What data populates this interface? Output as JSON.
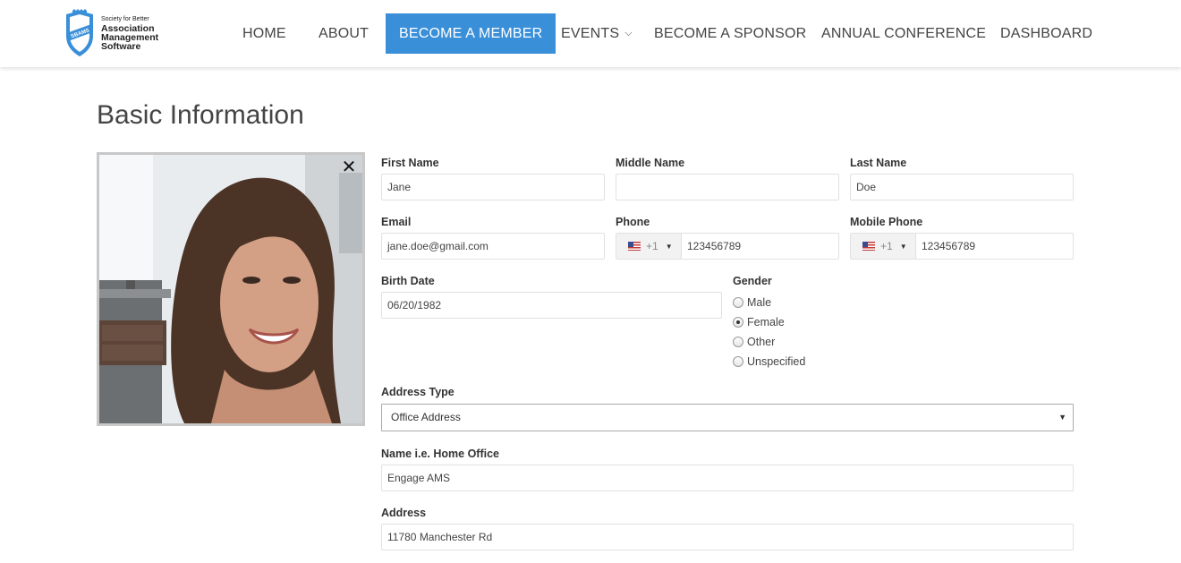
{
  "brand": {
    "small": "Society for Better",
    "line1": "Association",
    "line2": "Management",
    "line3": "Software",
    "shield_text": "SBAMS",
    "color": "#3a8fd9"
  },
  "nav": {
    "home": "HOME",
    "about": "ABOUT",
    "become_member": "BECOME A MEMBER",
    "events": "EVENTS",
    "become_sponsor": "BECOME A SPONSOR",
    "annual_conference": "ANNUAL CONFERENCE",
    "dashboard": "DASHBOARD",
    "active_color": "#3a8fd9"
  },
  "page": {
    "title": "Basic Information"
  },
  "photo": {
    "close_glyph": "✕"
  },
  "form": {
    "first_name": {
      "label": "First Name",
      "value": "Jane"
    },
    "middle_name": {
      "label": "Middle Name",
      "value": ""
    },
    "last_name": {
      "label": "Last Name",
      "value": "Doe"
    },
    "email": {
      "label": "Email",
      "value": "jane.doe@gmail.com"
    },
    "phone": {
      "label": "Phone",
      "code": "+1",
      "value": "123456789"
    },
    "mobile_phone": {
      "label": "Mobile Phone",
      "code": "+1",
      "value": "123456789"
    },
    "birth_date": {
      "label": "Birth Date",
      "value": "06/20/1982"
    },
    "gender": {
      "label": "Gender",
      "options": [
        "Male",
        "Female",
        "Other",
        "Unspecified"
      ],
      "selected": "Female"
    },
    "address_type": {
      "label": "Address Type",
      "value": "Office Address"
    },
    "address_name": {
      "label": "Name i.e. Home Office",
      "value": "Engage AMS"
    },
    "address": {
      "label": "Address",
      "value": "11780 Manchester Rd"
    }
  }
}
